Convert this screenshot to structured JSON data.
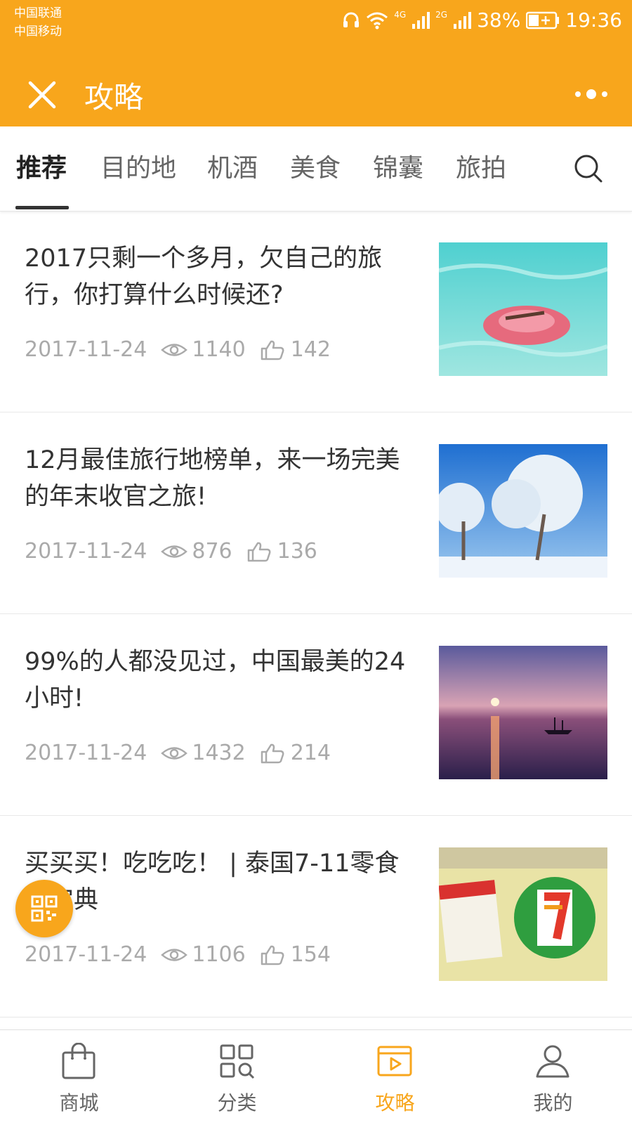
{
  "status_bar": {
    "carrier1": "中国联通",
    "carrier2": "中国移动",
    "network1": "4G",
    "network2": "2G",
    "battery": "38%",
    "time": "19:36"
  },
  "header": {
    "title": "攻略",
    "bg_color": "#f8a61c"
  },
  "tabs": [
    {
      "label": "推荐",
      "active": true
    },
    {
      "label": "目的地",
      "active": false
    },
    {
      "label": "机酒",
      "active": false
    },
    {
      "label": "美食",
      "active": false
    },
    {
      "label": "锦囊",
      "active": false
    },
    {
      "label": "旅拍",
      "active": false
    }
  ],
  "articles": [
    {
      "title": "2017只剩一个多月，欠自己的旅行，你打算什么时候还?",
      "date": "2017-11-24",
      "views": "1140",
      "likes": "142",
      "image": "pool-float-photo"
    },
    {
      "title": "12月最佳旅行地榜单，来一场完美的年末收官之旅!",
      "date": "2017-11-24",
      "views": "876",
      "likes": "136",
      "image": "snowy-trees-photo"
    },
    {
      "title": "99%的人都没见过，中国最美的24小时!",
      "date": "2017-11-24",
      "views": "1432",
      "likes": "214",
      "image": "sunset-sea-boat-photo"
    },
    {
      "title": "买买买！吃吃吃！ | 泰国7-11零食大宝典",
      "date": "2017-11-24",
      "views": "1106",
      "likes": "154",
      "image": "seven-eleven-sign-photo"
    }
  ],
  "bottom_nav": [
    {
      "label": "商城",
      "icon": "shopping-bag-icon",
      "active": false
    },
    {
      "label": "分类",
      "icon": "category-grid-icon",
      "active": false
    },
    {
      "label": "攻略",
      "icon": "video-play-icon",
      "active": true
    },
    {
      "label": "我的",
      "icon": "user-icon",
      "active": false
    }
  ],
  "accent_color": "#f8a61c"
}
